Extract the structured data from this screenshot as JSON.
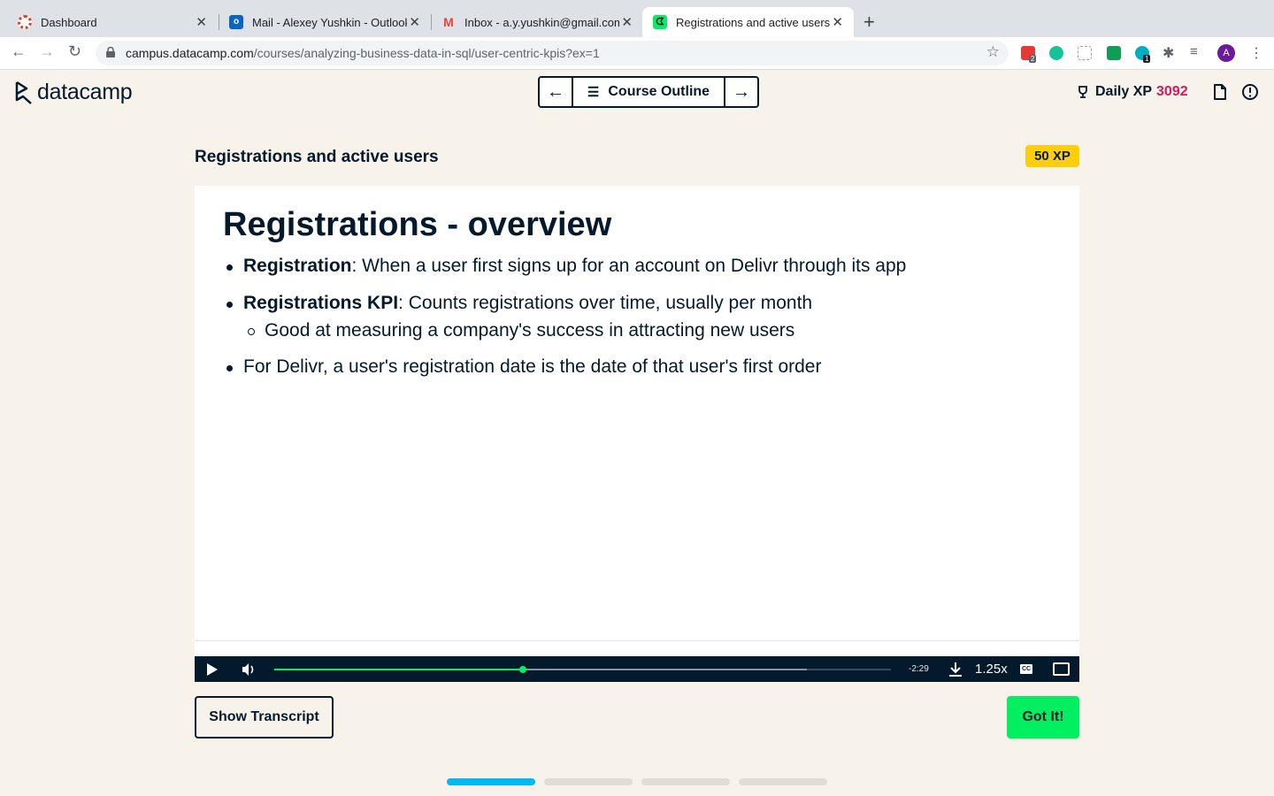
{
  "browser": {
    "tabs": [
      {
        "title": "Dashboard",
        "icon": "dashboard-favicon",
        "active": false
      },
      {
        "title": "Mail - Alexey Yushkin - Outlook",
        "icon": "outlook-favicon",
        "active": false
      },
      {
        "title": "Inbox - a.y.yushkin@gmail.com",
        "icon": "gmail-favicon",
        "active": false
      },
      {
        "title": "Registrations and active users",
        "icon": "datacamp-favicon",
        "active": true
      }
    ],
    "url_host": "campus.datacamp.com",
    "url_path": "/courses/analyzing-business-data-in-sql/user-centric-kpis?ex=1",
    "extension_badges": [
      "2",
      "1"
    ],
    "profile_initial": "A"
  },
  "header": {
    "logo_text": "datacamp",
    "course_outline_label": "Course Outline",
    "daily_xp_label": "Daily XP",
    "daily_xp_value": "3092"
  },
  "lesson": {
    "title": "Registrations and active users",
    "xp_badge": "50 XP"
  },
  "slide": {
    "heading": "Registrations - overview",
    "bullets": [
      {
        "term": "Registration",
        "text": ": When a user first signs up for an account on Delivr through its app"
      },
      {
        "term": "Registrations KPI",
        "text": ": Counts registrations over time, usually per month"
      },
      {
        "term": "",
        "text": "For Delivr, a user's registration date is the date of that user's first order"
      }
    ],
    "sub_bullet": "Good at measuring a company's success in attracting new users"
  },
  "player": {
    "time_remaining": "-2:29",
    "speed": "1.25x",
    "cc_label": "CC",
    "played_fraction": 0.403,
    "buffered_fraction": 0.863
  },
  "actions": {
    "show_transcript": "Show Transcript",
    "got_it": "Got It!"
  },
  "lesson_progress": {
    "segments": 4,
    "current": 1
  },
  "colors": {
    "background": "#f7f3eb",
    "navy": "#05192d",
    "green": "#03ef62",
    "xp_yellow": "#fcce0d",
    "xp_pink": "#d6195f",
    "progress_blue": "#05b8ef"
  }
}
